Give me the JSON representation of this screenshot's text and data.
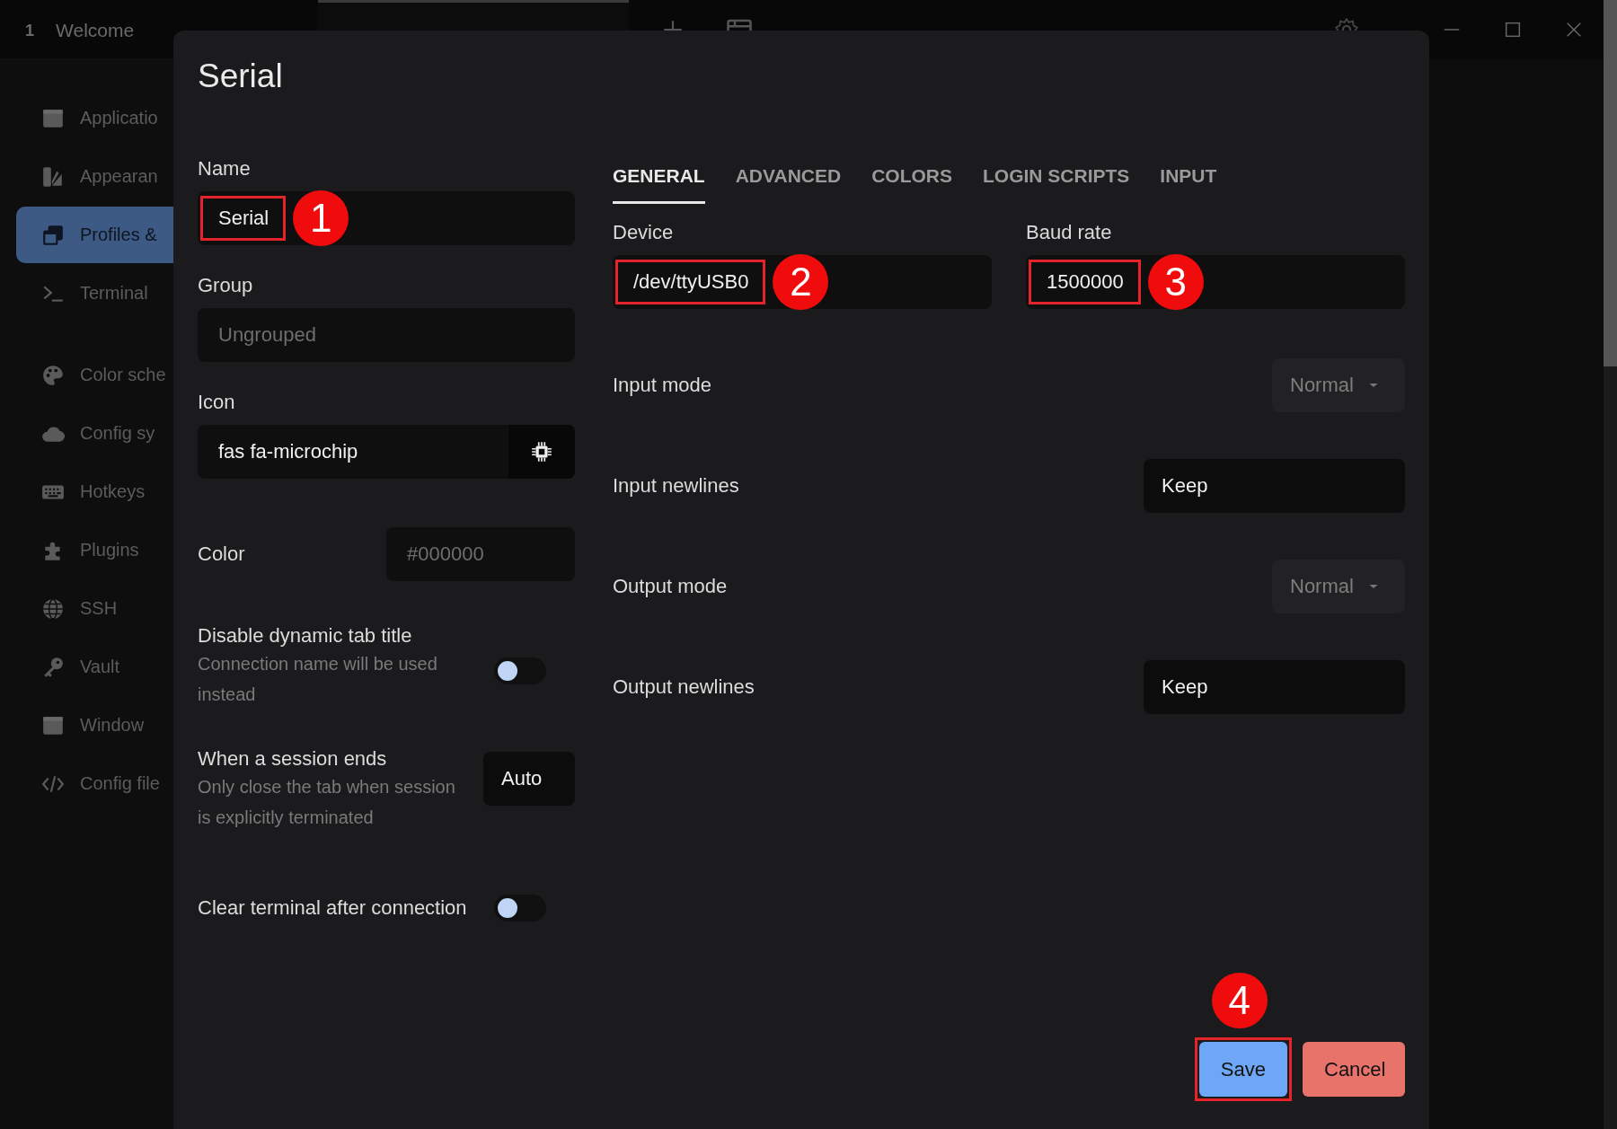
{
  "window_tabs": [
    {
      "number": "1",
      "label": "Welcome",
      "selected": false
    },
    {
      "selected": true
    }
  ],
  "sidebar": {
    "groups": [
      {
        "items": [
          {
            "label": "Applicatio",
            "selected": false
          },
          {
            "label": "Appearan",
            "selected": false
          },
          {
            "label": "Profiles &",
            "selected": true
          },
          {
            "label": "Terminal",
            "selected": false
          }
        ]
      },
      {
        "items": [
          {
            "label": "Color sche",
            "selected": false
          },
          {
            "label": "Config sy",
            "selected": false
          },
          {
            "label": "Hotkeys",
            "selected": false
          },
          {
            "label": "Plugins",
            "selected": false
          },
          {
            "label": "SSH",
            "selected": false
          },
          {
            "label": "Vault",
            "selected": false
          },
          {
            "label": "Window",
            "selected": false
          },
          {
            "label": "Config file",
            "selected": false
          }
        ]
      }
    ]
  },
  "dialog": {
    "title": "Serial",
    "left_fields": [
      {
        "kind": "text",
        "label": "Name",
        "value": "Serial",
        "callout": "1"
      },
      {
        "kind": "text",
        "label": "Group",
        "placeholder": "Ungrouped"
      },
      {
        "kind": "icon",
        "label": "Icon",
        "value": "fas fa-microchip"
      },
      {
        "kind": "color",
        "label": "Color",
        "placeholder": "#000000"
      },
      {
        "kind": "toggle",
        "label": "Disable dynamic tab title",
        "description": "Connection name will be used instead",
        "on": false
      },
      {
        "kind": "select",
        "label": "When a session ends",
        "description": "Only close the tab when session is explicitly terminated",
        "value": "Auto"
      },
      {
        "kind": "toggle",
        "label": "Clear terminal after connection",
        "on": false
      }
    ],
    "tabs": [
      {
        "label": "GENERAL",
        "selected": true
      },
      {
        "label": "ADVANCED",
        "selected": false
      },
      {
        "label": "COLORS",
        "selected": false
      },
      {
        "label": "LOGIN SCRIPTS",
        "selected": false
      },
      {
        "label": "INPUT",
        "selected": false
      }
    ],
    "connection_fields": [
      {
        "label": "Device",
        "value": "/dev/ttyUSB0",
        "callout": "2"
      },
      {
        "label": "Baud rate",
        "value": "1500000",
        "callout": "3"
      }
    ],
    "options": [
      {
        "kind": "dropdown",
        "label": "Input mode",
        "value": "Normal",
        "disabled": true
      },
      {
        "kind": "select",
        "label": "Input newlines",
        "value": "Keep"
      },
      {
        "kind": "dropdown",
        "label": "Output mode",
        "value": "Normal",
        "disabled": true
      },
      {
        "kind": "select",
        "label": "Output newlines",
        "value": "Keep"
      }
    ],
    "buttons": [
      {
        "kind": "primary",
        "label": "Save",
        "callout": "4"
      },
      {
        "kind": "danger",
        "label": "Cancel"
      }
    ]
  }
}
